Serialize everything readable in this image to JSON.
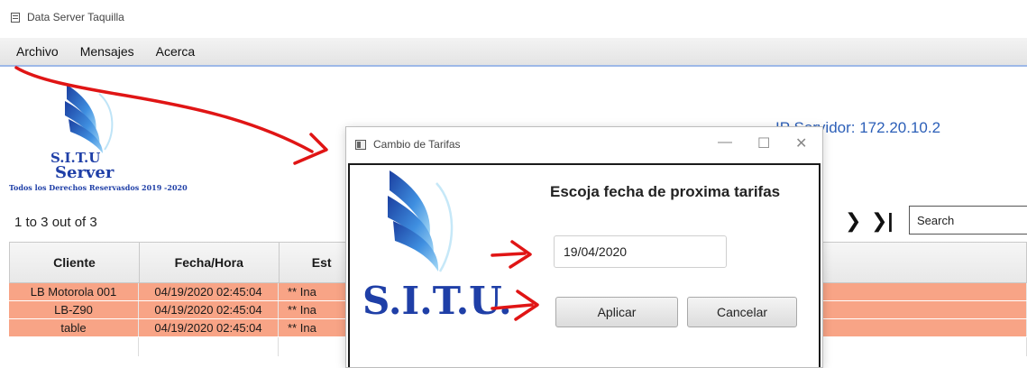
{
  "window": {
    "title": "Data Server Taquilla"
  },
  "menu": {
    "items": [
      "Archivo",
      "Mensajes",
      "Acerca"
    ]
  },
  "logo": {
    "line1": "S.I.T.U",
    "line2": "Server",
    "tagline": "Todos los Derechos Reservasdos 2019 -2020"
  },
  "server": {
    "ip_label": "IP Servidor: 172.20.10.2"
  },
  "pagination": {
    "summary": "1 to 3 out of 3",
    "next_glyph": "❯",
    "last_glyph": "❯|"
  },
  "search": {
    "placeholder": "Search"
  },
  "table": {
    "headers": [
      "Cliente",
      "Fecha/Hora",
      "Est"
    ],
    "rows": [
      {
        "cliente": "LB Motorola 001",
        "fecha": "04/19/2020 02:45:04",
        "estado": "** Ina"
      },
      {
        "cliente": "LB-Z90",
        "fecha": "04/19/2020 02:45:04",
        "estado": "** Ina"
      },
      {
        "cliente": "table",
        "fecha": "04/19/2020 02:45:04",
        "estado": "** Ina"
      }
    ]
  },
  "dialog": {
    "title": "Cambio de Tarifas",
    "controls": {
      "minimize": "—",
      "maximize": "☐",
      "close": "✕"
    },
    "heading": "Escoja fecha de proxima tarifas",
    "date_value": "19/04/2020",
    "apply_label": "Aplicar",
    "cancel_label": "Cancelar",
    "logo_text": "S.I.T.U."
  },
  "colors": {
    "row_highlight": "#f8a486",
    "brand_blue": "#1f3fa7",
    "annotation_red": "#e01515",
    "menubar_border": "#9db8e8"
  },
  "icons": [
    "window-icon",
    "next-page-icon",
    "last-page-icon",
    "dialog-window-icon",
    "situ-logo"
  ]
}
